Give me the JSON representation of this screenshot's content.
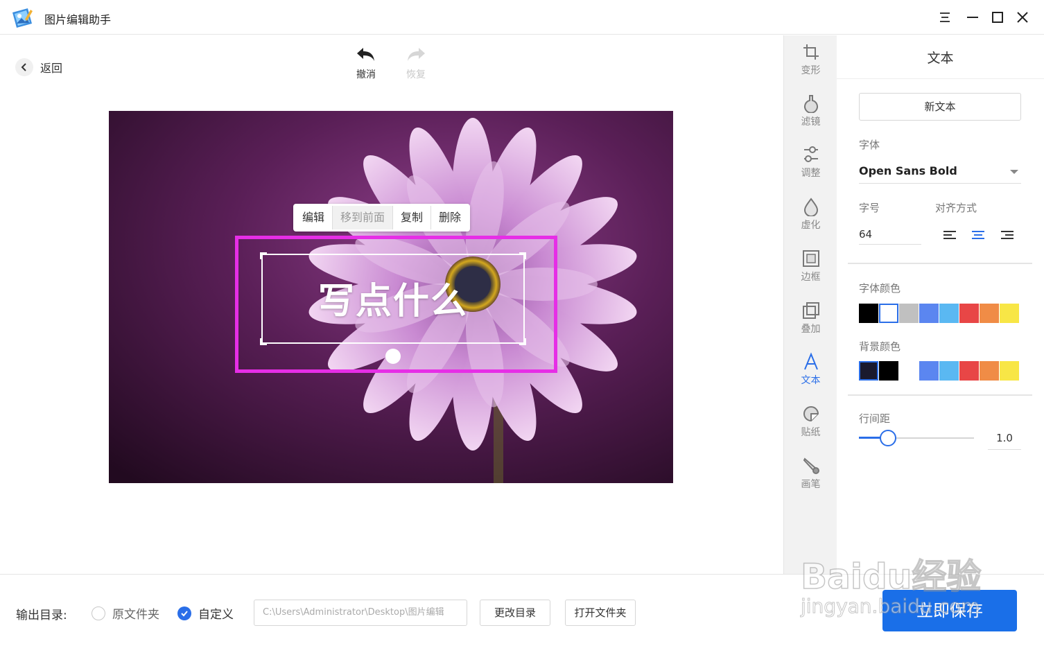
{
  "app": {
    "title": "图片编辑助手"
  },
  "nav": {
    "back_label": "返回"
  },
  "history": {
    "undo_label": "撤消",
    "redo_label": "恢复"
  },
  "context_menu": {
    "edit": "编辑",
    "bring_front": "移到前面",
    "copy": "复制",
    "delete": "删除"
  },
  "canvas": {
    "text": "写点什么"
  },
  "tools": [
    {
      "label": "变形",
      "icon": "crop-icon"
    },
    {
      "label": "滤镜",
      "icon": "filter-flask-icon"
    },
    {
      "label": "调整",
      "icon": "adjust-icon"
    },
    {
      "label": "虚化",
      "icon": "blur-drop-icon"
    },
    {
      "label": "边框",
      "icon": "border-frame-icon"
    },
    {
      "label": "叠加",
      "icon": "overlay-icon"
    },
    {
      "label": "文本",
      "icon": "text-a-icon",
      "active": true
    },
    {
      "label": "贴纸",
      "icon": "sticker-icon"
    },
    {
      "label": "画笔",
      "icon": "brush-icon"
    }
  ],
  "panel": {
    "title": "文本",
    "new_text": "新文本",
    "font_label": "字体",
    "font_value": "Open Sans Bold",
    "size_label": "字号",
    "size_value": "64",
    "align_label": "对齐方式",
    "font_color_label": "字体颜色",
    "bg_color_label": "背景颜色",
    "line_spacing_label": "行间距",
    "line_spacing_value": "1.0",
    "line_spacing_fraction": 0.25,
    "font_colors": [
      "#000000",
      "#ffffff",
      "#c0c0c0",
      "#5b86f0",
      "#5ab8f2",
      "#e84646",
      "#f08c46",
      "#f8e646"
    ],
    "bg_colors": [
      "#1a1a2e",
      "#000000",
      "#ffffff",
      "#5b86f0",
      "#5ab8f2",
      "#e84646",
      "#f08c46",
      "#f8e646"
    ]
  },
  "bottom": {
    "output_label": "输出目录:",
    "option_original": "原文件夹",
    "option_custom": "自定义",
    "path_value": "C:\\Users\\Administrator\\Desktop\\图片编辑",
    "change_dir": "更改目录",
    "open_folder": "打开文件夹",
    "save_now": "立即保存"
  },
  "watermark": {
    "main": "Baidu经验",
    "sub": "jingyan.baidu.com"
  },
  "colors": {
    "accent": "#2a6ee8",
    "highlight": "#e62ee6"
  }
}
